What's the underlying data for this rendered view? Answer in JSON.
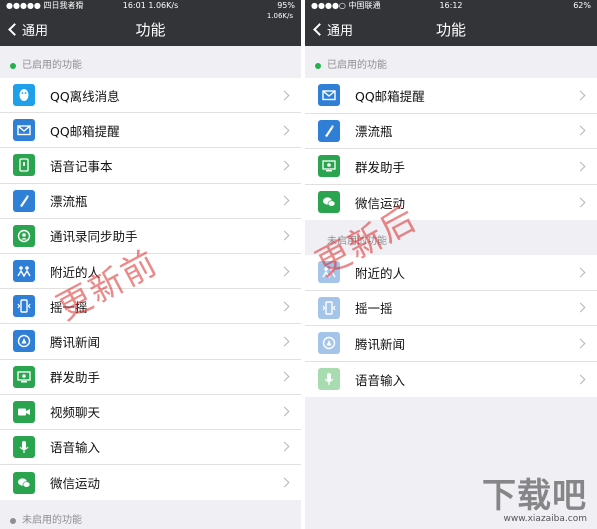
{
  "left": {
    "status": {
      "carrier": "●●●●● 四日我者猾 ",
      "time": "16:01 1.06K/s",
      "battery": "95%",
      "speed": "1.06K/s"
    },
    "nav": {
      "back_label": "通用",
      "title": "功能"
    },
    "enabled_header": "已启用的功能",
    "enabled_items": [
      {
        "label": "QQ离线消息",
        "icon": "qq-penguin-icon",
        "color": "#1fa0e8"
      },
      {
        "label": "QQ邮箱提醒",
        "icon": "mail-icon",
        "color": "#2f7fd6"
      },
      {
        "label": "语音记事本",
        "icon": "voice-note-icon",
        "color": "#2aa44f"
      },
      {
        "label": "漂流瓶",
        "icon": "bottle-icon",
        "color": "#2f7fd6"
      },
      {
        "label": "通讯录同步助手",
        "icon": "contact-sync-icon",
        "color": "#2aa44f"
      },
      {
        "label": "附近的人",
        "icon": "people-nearby-icon",
        "color": "#2f7fd6"
      },
      {
        "label": "摇一摇",
        "icon": "shake-icon",
        "color": "#2f7fd6"
      },
      {
        "label": "腾讯新闻",
        "icon": "news-icon",
        "color": "#2f7fd6"
      },
      {
        "label": "群发助手",
        "icon": "broadcast-icon",
        "color": "#2aa44f"
      },
      {
        "label": "视频聊天",
        "icon": "video-chat-icon",
        "color": "#2aa44f"
      },
      {
        "label": "语音输入",
        "icon": "microphone-icon",
        "color": "#2aa44f"
      },
      {
        "label": "微信运动",
        "icon": "wechat-sport-icon",
        "color": "#2aa44f"
      }
    ],
    "disabled_header": "未启用的功能",
    "watermark": "更新前"
  },
  "right": {
    "status": {
      "carrier": "●●●●○ 中国联通",
      "time": "16:12",
      "battery": "62%"
    },
    "nav": {
      "back_label": "通用",
      "title": "功能"
    },
    "enabled_header": "已启用的功能",
    "enabled_items": [
      {
        "label": "QQ邮箱提醒",
        "icon": "mail-icon",
        "color": "#2f7fd6"
      },
      {
        "label": "漂流瓶",
        "icon": "bottle-icon",
        "color": "#2f7fd6"
      },
      {
        "label": "群发助手",
        "icon": "broadcast-icon",
        "color": "#2aa44f"
      },
      {
        "label": "微信运动",
        "icon": "wechat-sport-icon",
        "color": "#2aa44f"
      }
    ],
    "disabled_header": "未启用的功能",
    "disabled_items": [
      {
        "label": "附近的人",
        "icon": "people-nearby-icon",
        "color": "#a5c4ea"
      },
      {
        "label": "摇一摇",
        "icon": "shake-icon",
        "color": "#a5c4ea"
      },
      {
        "label": "腾讯新闻",
        "icon": "news-icon",
        "color": "#a5c4ea"
      },
      {
        "label": "语音输入",
        "icon": "microphone-icon",
        "color": "#a8dbb0"
      }
    ],
    "watermark": "更新后"
  },
  "brand": {
    "logo": "下载吧",
    "url": "www.xiazaiba.com"
  }
}
